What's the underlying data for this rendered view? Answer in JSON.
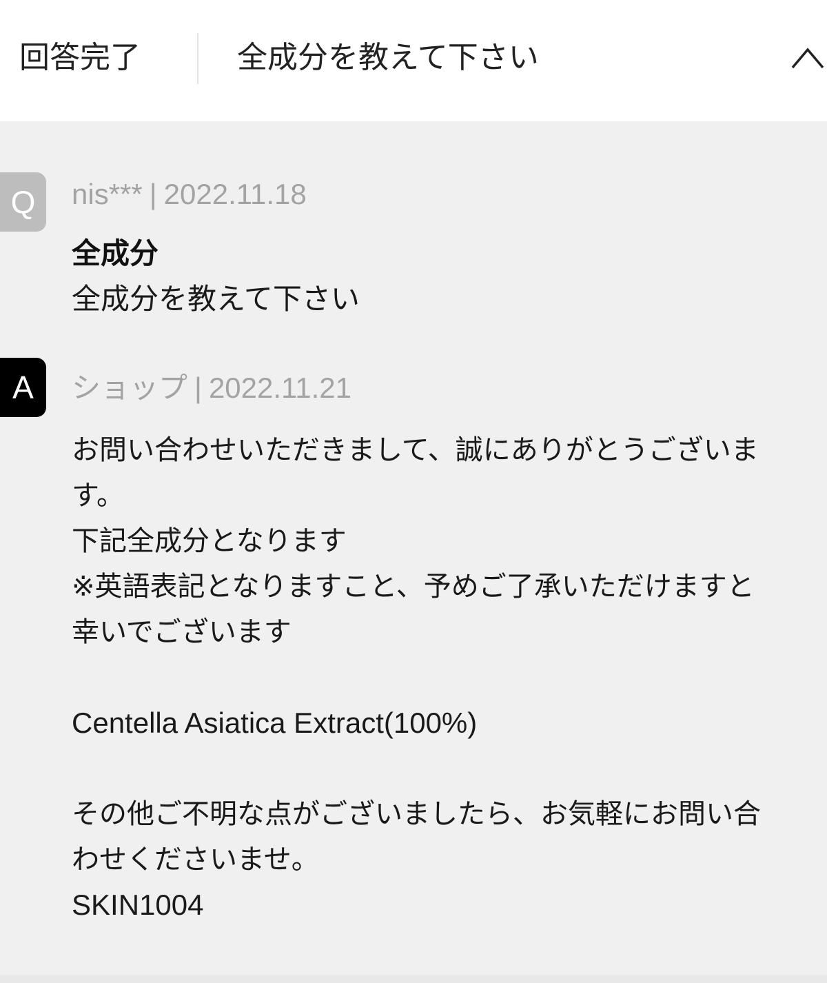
{
  "header": {
    "status": "回答完了",
    "title": "全成分を教えて下さい",
    "collapse_icon": "chevron-up-icon"
  },
  "question": {
    "badge": "Q",
    "user": "nis***",
    "separator": "|",
    "date": "2022.11.18",
    "subject": "全成分",
    "body": "全成分を教えて下さい"
  },
  "answer": {
    "badge": "A",
    "user": "ショップ",
    "separator": "|",
    "date": "2022.11.21",
    "lines": {
      "l1": "お問い合わせいただきまして、誠にありがとうございま",
      "l2": "す。",
      "l3": "下記全成分となります",
      "l4": "※英語表記となりますこと、予めご了承いただけますと",
      "l5": "幸いでございます",
      "l6": "Centella Asiatica Extract(100%)",
      "l7": "その他ご不明な点がございましたら、お気軽にお問い合",
      "l8": "わせくださいませ。",
      "l9": "SKIN1004"
    }
  },
  "colors": {
    "q_badge": "#bdbdbd",
    "a_badge": "#000000",
    "panel_bg": "#f0f0f1",
    "meta_text": "#a3a3a3"
  }
}
